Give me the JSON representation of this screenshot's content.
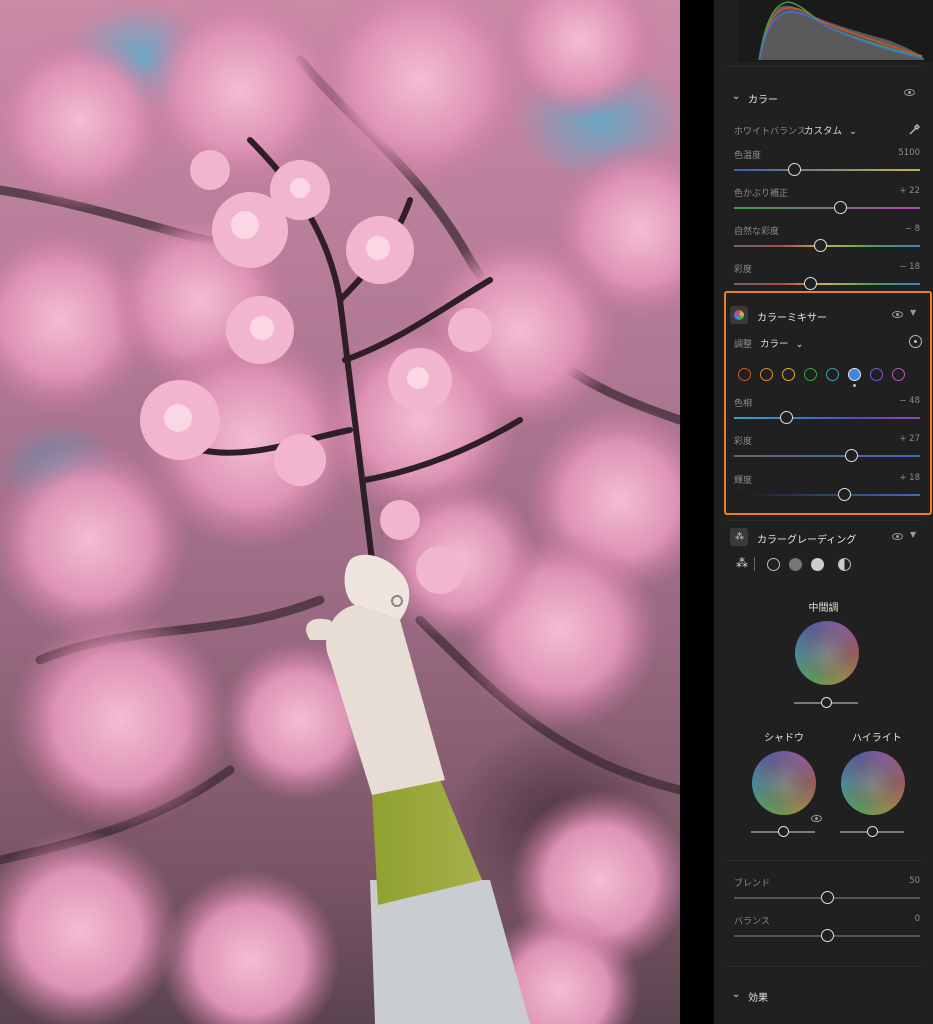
{
  "color_section": {
    "title": "カラー",
    "white_balance": {
      "label": "ホワイトバランス",
      "value": "カスタム"
    },
    "sliders": [
      {
        "label": "色温度",
        "value": "5100",
        "pos": 0.32,
        "track": "linear-gradient(90deg,#3a5fae,#c9b14a)"
      },
      {
        "label": "色かぶり補正",
        "value": "+ 22",
        "pos": 0.57,
        "track": "linear-gradient(90deg,#3f9e4a,#b447b4)"
      },
      {
        "label": "自然な彩度",
        "value": "− 8",
        "pos": 0.46,
        "track": "linear-gradient(90deg,#6a6a6a,#b44a4a,#c9b14a,#4aa04a,#4a7ac9)"
      },
      {
        "label": "彩度",
        "value": "− 18",
        "pos": 0.41,
        "track": "linear-gradient(90deg,#6a6a6a,#b44a4a,#c9b14a,#4aa04a,#4a7ac9)"
      }
    ]
  },
  "color_mixer": {
    "title": "カラーミキサー",
    "adjust_label": "調整",
    "adjust_value": "カラー",
    "swatches": [
      "#d4542a",
      "#e48a2a",
      "#e0b030",
      "#3fa04a",
      "#38a8a8",
      "#3a8ae0",
      "#7a58d0",
      "#c054b8"
    ],
    "selected_swatch": 5,
    "sliders": [
      {
        "label": "色相",
        "value": "− 48",
        "pos": 0.28,
        "track": "linear-gradient(90deg,#3aa0c8,#3a7ad0,#5a4ab8,#8a4ab8)"
      },
      {
        "label": "彩度",
        "value": "+ 27",
        "pos": 0.63,
        "track": "linear-gradient(90deg,#6a6a6a,#3a6ac8)"
      },
      {
        "label": "輝度",
        "value": "+ 18",
        "pos": 0.59,
        "track": "linear-gradient(90deg,#1a1a1a,#4a6ab8)"
      }
    ]
  },
  "color_grading": {
    "title": "カラーグレーディング",
    "midtone_label": "中間調",
    "shadow_label": "シャドウ",
    "highlight_label": "ハイライト",
    "sliders": [
      {
        "label": "ブレンド",
        "value": "50",
        "pos": 0.5
      },
      {
        "label": "バランス",
        "value": "0",
        "pos": 0.5
      }
    ]
  },
  "effects_section": {
    "title": "効果"
  },
  "colors": {
    "accent": "#f07d20",
    "panel_bg": "#202020"
  }
}
